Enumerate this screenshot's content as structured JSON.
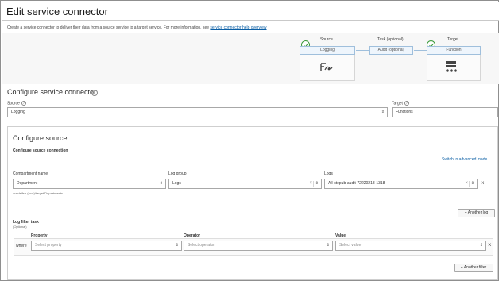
{
  "page": {
    "title": "Edit service connector",
    "description": "Create a service connector to deliver their data from a source service to a target service. For more information, see",
    "description_link": "service connector help overview"
  },
  "flow": {
    "source": {
      "header": "Source",
      "value": "Logging"
    },
    "task": {
      "header": "Task (optional)",
      "value": "Audit (optional)"
    },
    "target": {
      "header": "Target",
      "value": "Function"
    }
  },
  "configure_connector": {
    "title": "Configure service connector",
    "source_label": "Source",
    "source_value": "Logging",
    "target_label": "Target",
    "target_value": "Functions"
  },
  "configure_source": {
    "title": "Configure source",
    "subtitle": "Configure source connection",
    "advanced_link": "Switch to advanced mode",
    "compartment_label": "Compartment name",
    "compartment_value": "Department",
    "compartment_path": "oracleifse (root)/target/Departments",
    "log_group_label": "Log group",
    "log_group_value": "Logs",
    "logs_label": "Logs",
    "logs_value": "All-stepub-audit-72220218-1318",
    "another_log_button": "Another log",
    "filter_title": "Log filter task",
    "filter_optional": "(Optional)",
    "where_label": "where",
    "property_label": "Property",
    "property_placeholder": "Select property",
    "operator_label": "Operator",
    "operator_placeholder": "Select operator",
    "value_label": "Value",
    "value_placeholder": "Select value",
    "another_filter_button": "Another filter"
  },
  "colors": {
    "accent": "#0b5fa5",
    "check_green": "#3a9a3a",
    "node_border": "#9fbfdc"
  },
  "icons": [
    "check-icon",
    "info-icon",
    "help-icon",
    "chevron-icon",
    "clear-icon",
    "close-icon",
    "plus-icon",
    "function-icon",
    "logging-icon"
  ]
}
